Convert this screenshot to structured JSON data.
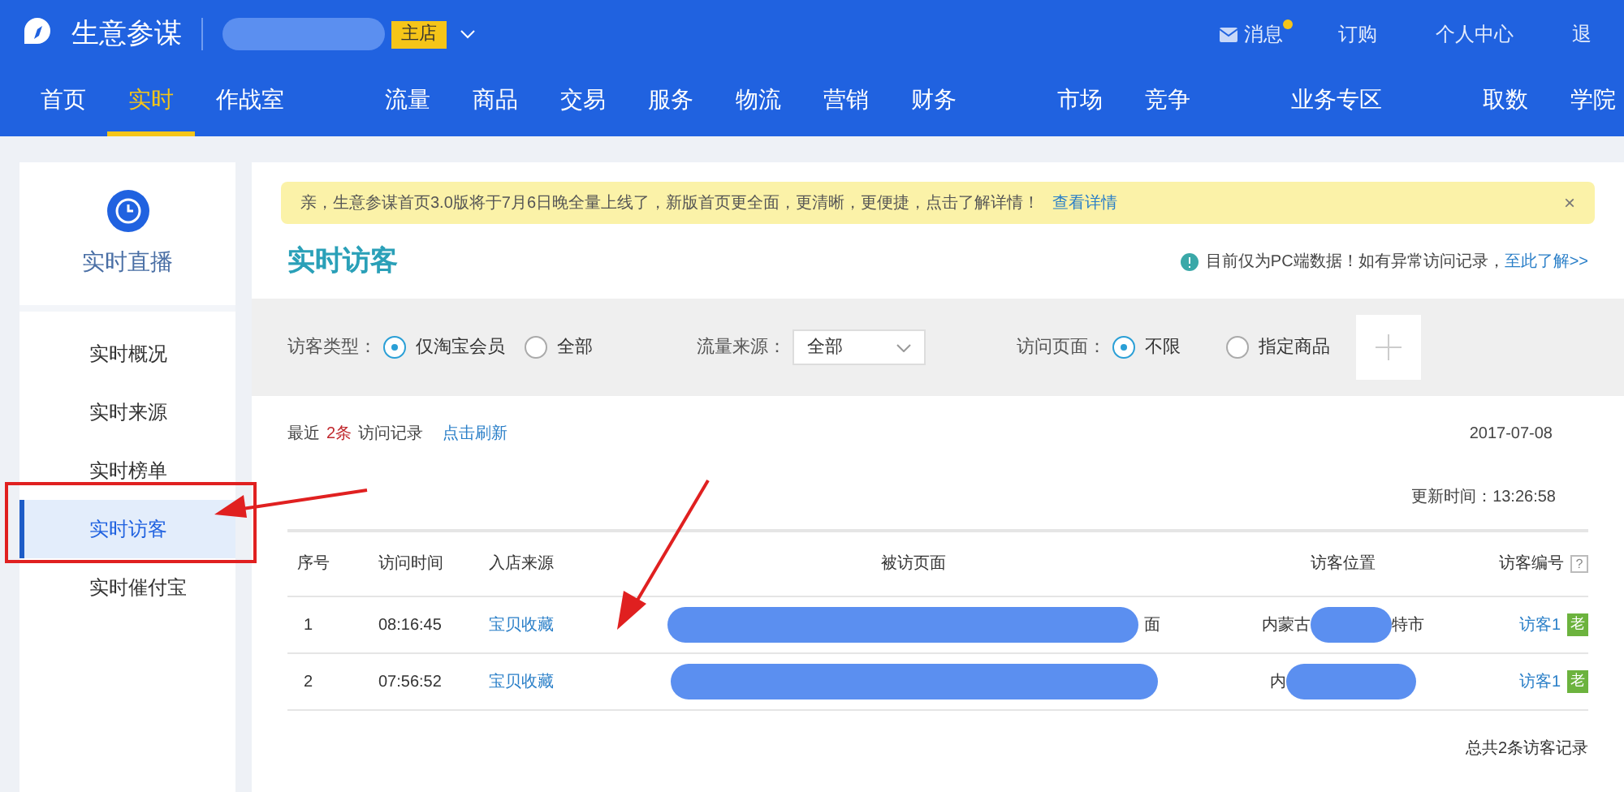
{
  "header": {
    "brand": "生意参谋",
    "shop_badge": "主店",
    "links": [
      {
        "label": "消息",
        "unread": true
      },
      {
        "label": "订购",
        "unread": false
      },
      {
        "label": "个人中心",
        "unread": false
      },
      {
        "label": "退",
        "unread": false
      }
    ]
  },
  "nav": {
    "groups": [
      [
        {
          "label": "首页",
          "selected": false
        },
        {
          "label": "实时",
          "selected": true
        },
        {
          "label": "作战室",
          "selected": false
        }
      ],
      [
        {
          "label": "流量",
          "selected": false
        },
        {
          "label": "商品",
          "selected": false
        },
        {
          "label": "交易",
          "selected": false
        },
        {
          "label": "服务",
          "selected": false
        },
        {
          "label": "物流",
          "selected": false
        },
        {
          "label": "营销",
          "selected": false
        },
        {
          "label": "财务",
          "selected": false
        }
      ],
      [
        {
          "label": "市场",
          "selected": false
        },
        {
          "label": "竞争",
          "selected": false
        }
      ],
      [
        {
          "label": "业务专区",
          "selected": false
        }
      ],
      [
        {
          "label": "取数",
          "selected": false
        },
        {
          "label": "学院",
          "selected": false
        }
      ]
    ]
  },
  "sidebar": {
    "title": "实时直播",
    "items": [
      {
        "label": "实时概况",
        "selected": false
      },
      {
        "label": "实时来源",
        "selected": false
      },
      {
        "label": "实时榜单",
        "selected": false
      },
      {
        "label": "实时访客",
        "selected": true
      },
      {
        "label": "实时催付宝",
        "selected": false
      }
    ]
  },
  "notice": {
    "text": "亲，生意参谋首页3.0版将于7月6日晚全量上线了，新版首页更全面，更清晰，更便捷，点击了解详情！",
    "link": "查看详情",
    "close": "×"
  },
  "page": {
    "title": "实时访客",
    "info": "目前仅为PC端数据！如有异常访问记录，",
    "info_link": "至此了解>>"
  },
  "filters": {
    "visitor_type": {
      "label": "访客类型：",
      "options": [
        {
          "label": "仅淘宝会员",
          "selected": true
        },
        {
          "label": "全部",
          "selected": false
        }
      ]
    },
    "source": {
      "label": "流量来源：",
      "value": "全部"
    },
    "visit_page": {
      "label": "访问页面：",
      "options": [
        {
          "label": "不限",
          "selected": true
        },
        {
          "label": "指定商品",
          "selected": false
        }
      ]
    }
  },
  "records": {
    "prefix": "最近",
    "count": "2条",
    "suffix": "访问记录",
    "refresh": "点击刷新",
    "date": "2017-07-08",
    "updated": "更新时间：13:26:58"
  },
  "table": {
    "columns": [
      "序号",
      "访问时间",
      "入店来源",
      "被访页面",
      "访客位置",
      "访客编号"
    ],
    "rows": [
      {
        "no": "1",
        "time": "08:16:45",
        "source": "宝贝收藏",
        "page_tail": "面",
        "location_head": "内蒙古",
        "location_tail": "特市",
        "visitor": "访客1",
        "tag": "老"
      },
      {
        "no": "2",
        "time": "07:56:52",
        "source": "宝贝收藏",
        "page_tail": "",
        "location_head": "内",
        "location_tail": "",
        "visitor": "访客1",
        "tag": "老"
      }
    ],
    "help": "?",
    "total": "总共2条访客记录"
  }
}
